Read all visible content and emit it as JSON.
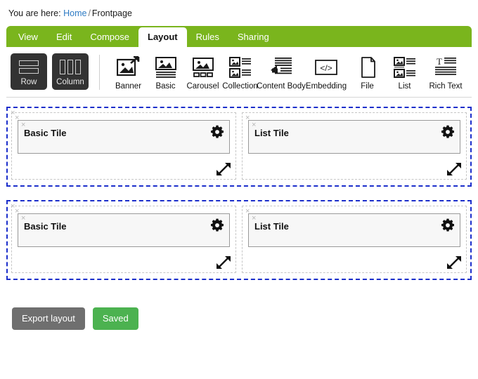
{
  "breadcrumb": {
    "label": "You are here:",
    "home": "Home",
    "separator": "/",
    "current": "Frontpage"
  },
  "tabs": [
    {
      "label": "View",
      "active": false
    },
    {
      "label": "Edit",
      "active": false
    },
    {
      "label": "Compose",
      "active": false
    },
    {
      "label": "Layout",
      "active": true
    },
    {
      "label": "Rules",
      "active": false
    },
    {
      "label": "Sharing",
      "active": false
    }
  ],
  "toolbar": {
    "structure": [
      {
        "label": "Row",
        "icon": "row-icon"
      },
      {
        "label": "Column",
        "icon": "column-icon"
      }
    ],
    "tiles": [
      {
        "label": "Banner",
        "icon": "banner-icon"
      },
      {
        "label": "Basic",
        "icon": "basic-icon"
      },
      {
        "label": "Carousel",
        "icon": "carousel-icon"
      },
      {
        "label": "Collection",
        "icon": "collection-icon"
      },
      {
        "label": "Content Body",
        "icon": "content-body-icon"
      },
      {
        "label": "Embedding",
        "icon": "embedding-icon"
      },
      {
        "label": "File",
        "icon": "file-icon"
      },
      {
        "label": "List",
        "icon": "list-icon"
      },
      {
        "label": "Rich Text",
        "icon": "rich-text-icon"
      }
    ]
  },
  "canvas": {
    "close_glyph": "×",
    "rows": [
      {
        "columns": [
          {
            "tile_title": "Basic Tile"
          },
          {
            "tile_title": "List Tile"
          }
        ]
      },
      {
        "columns": [
          {
            "tile_title": "Basic Tile"
          },
          {
            "tile_title": "List Tile"
          }
        ]
      }
    ]
  },
  "footer": {
    "export_label": "Export layout",
    "save_label": "Saved"
  },
  "colors": {
    "tabbar_green": "#7ab51d",
    "row_outline_blue": "#1b2ecb",
    "col_outline_grey": "#c6c6c6",
    "btn_grey": "#6f6f6f",
    "btn_green": "#4cb250",
    "link_blue": "#2e7bc4"
  }
}
